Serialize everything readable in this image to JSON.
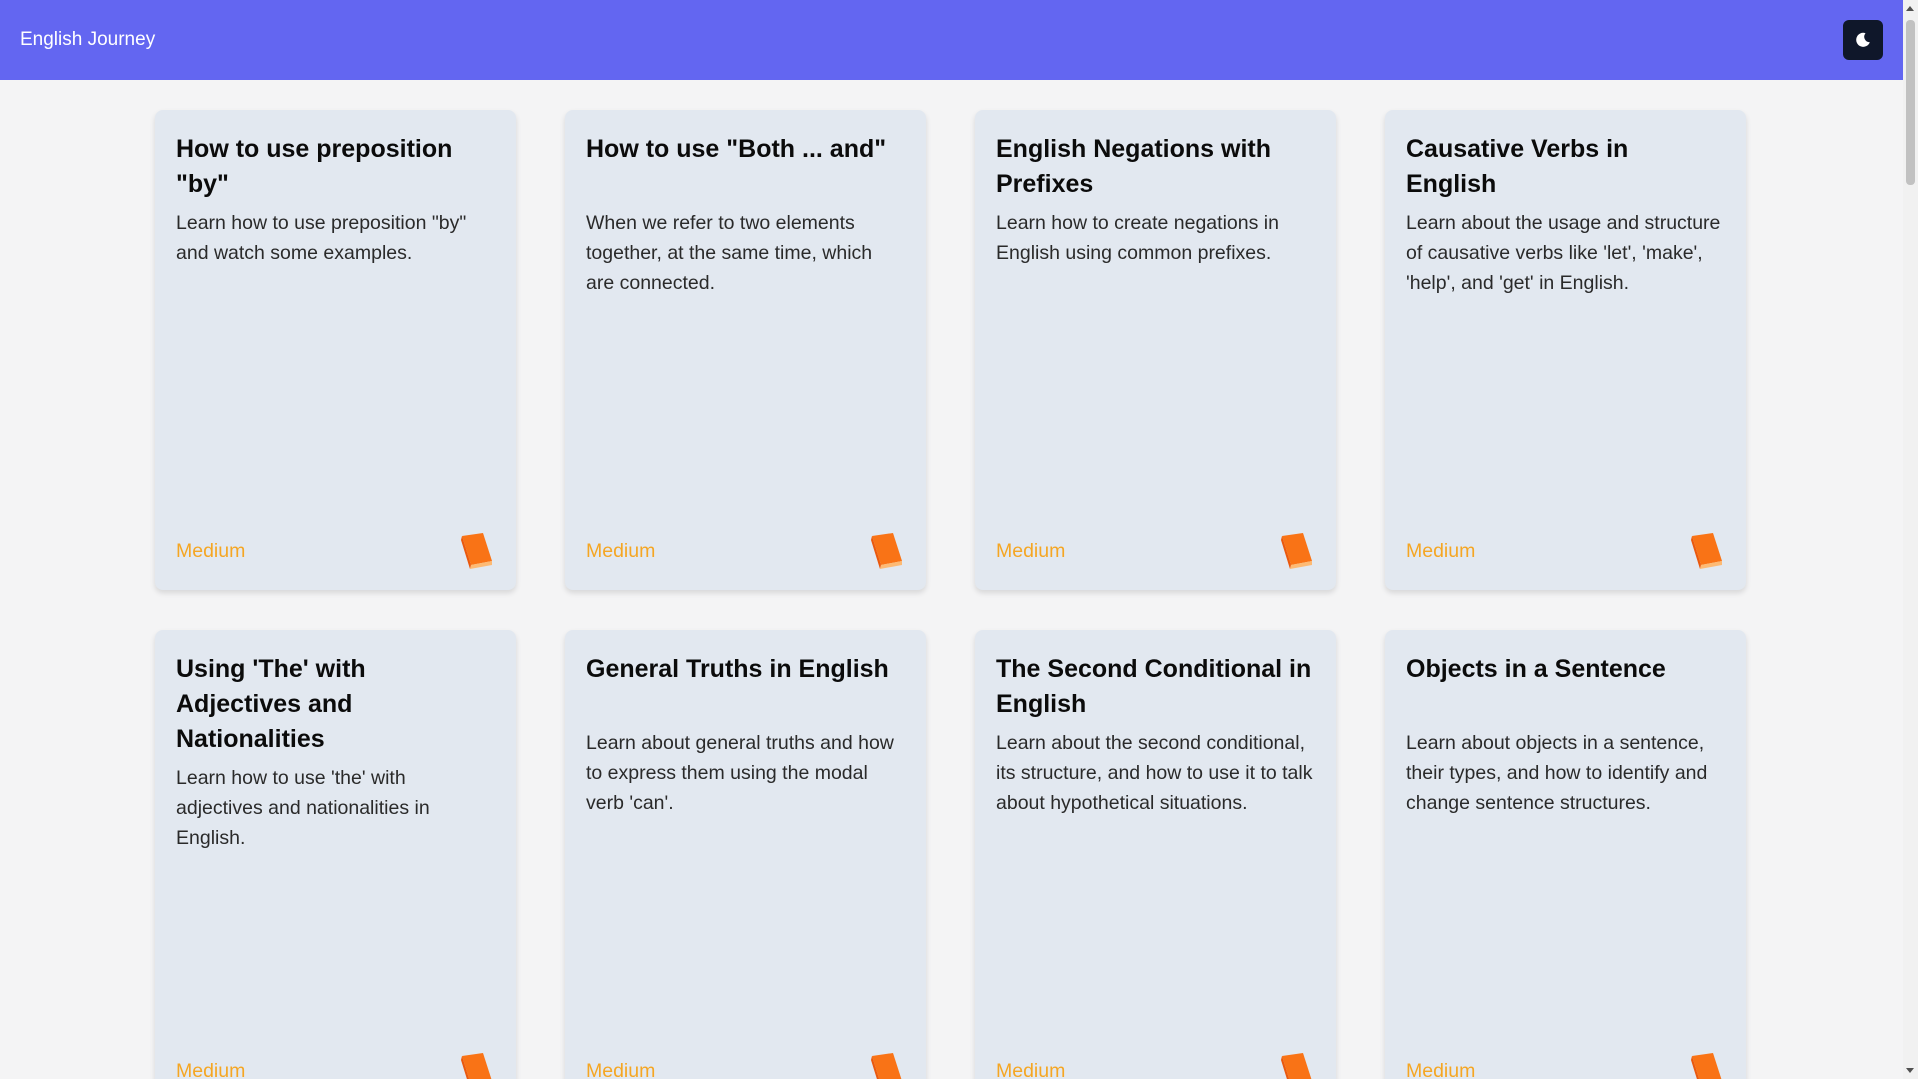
{
  "app": {
    "brand": "English Journey",
    "theme_toggle_icon": "moon-icon"
  },
  "colors": {
    "navbar": "#6366f1",
    "card_bg": "#e2e8f0",
    "difficulty": "#f5a623",
    "book_icon": "#f97316"
  },
  "cards": [
    {
      "title": "How to use preposition \"by\"",
      "description": "Learn how to use preposition \"by\" and watch some examples.",
      "difficulty": "Medium",
      "icon": "book-icon"
    },
    {
      "title": "How to use \"Both ... and\"",
      "description": "When we refer to two elements together, at the same time, which are connected.",
      "difficulty": "Medium",
      "icon": "book-icon"
    },
    {
      "title": "English Negations with Prefixes",
      "description": "Learn how to create negations in English using common prefixes.",
      "difficulty": "Medium",
      "icon": "book-icon"
    },
    {
      "title": "Causative Verbs in English",
      "description": "Learn about the usage and structure of causative verbs like 'let', 'make', 'help', and 'get' in English.",
      "difficulty": "Medium",
      "icon": "book-icon"
    },
    {
      "title": "Using 'The' with Adjectives and Nationalities",
      "description": "Learn how to use 'the' with adjectives and nationalities in English.",
      "difficulty": "Medium",
      "icon": "book-icon"
    },
    {
      "title": "General Truths in English",
      "description": "Learn about general truths and how to express them using the modal verb 'can'.",
      "difficulty": "Medium",
      "icon": "book-icon"
    },
    {
      "title": "The Second Conditional in English",
      "description": "Learn about the second conditional, its structure, and how to use it to talk about hypothetical situations.",
      "difficulty": "Medium",
      "icon": "book-icon"
    },
    {
      "title": "Objects in a Sentence",
      "description": "Learn about objects in a sentence, their types, and how to identify and change sentence structures.",
      "difficulty": "Medium",
      "icon": "book-icon"
    }
  ]
}
